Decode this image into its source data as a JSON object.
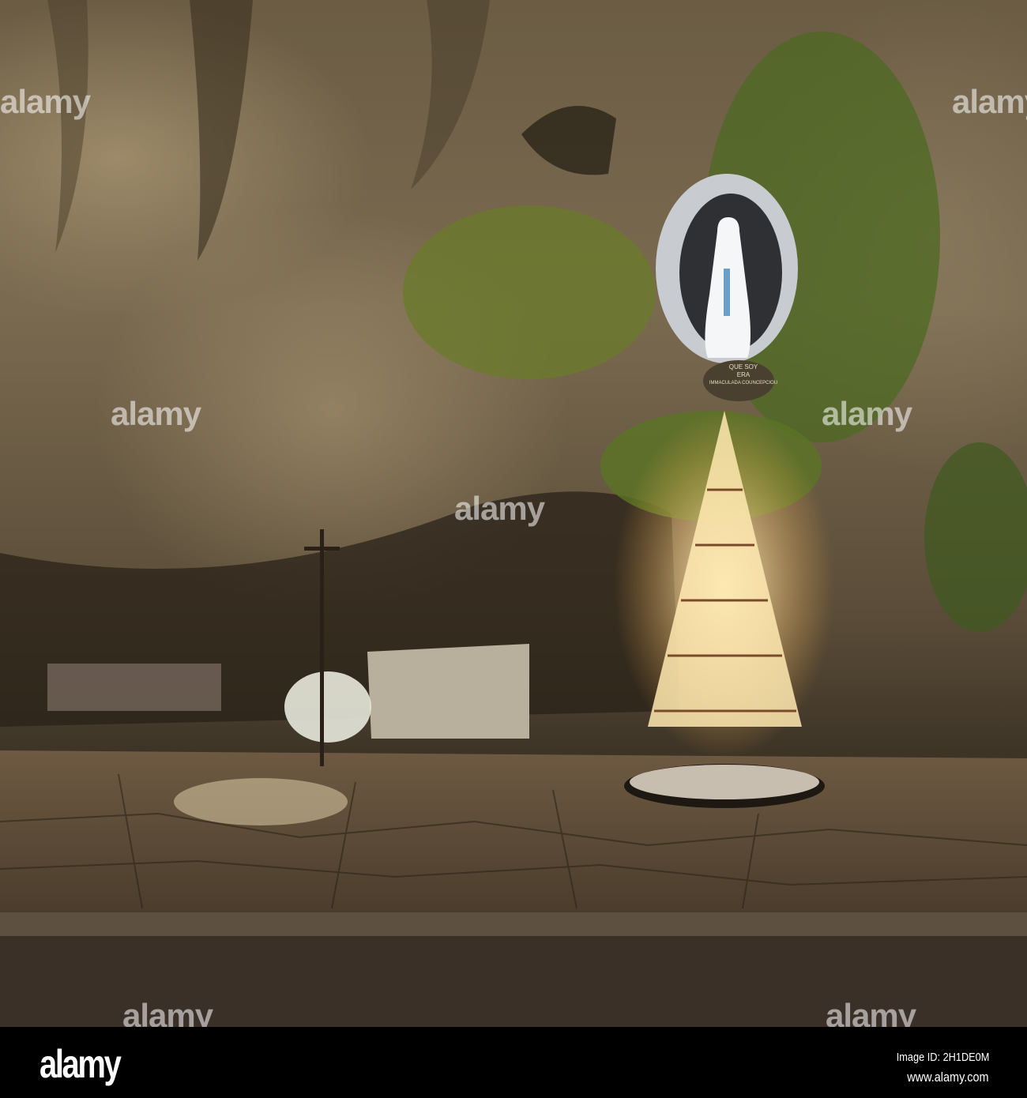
{
  "watermark": {
    "text": "alamy"
  },
  "inscription": {
    "line1": "QUE SOY",
    "line2": "ERA",
    "line3": "IMMACULADA COUNCEPCIOU"
  },
  "footer": {
    "logo": "alamy",
    "image_id": "Image ID: 2H1DE0M",
    "url": "www.alamy.com"
  }
}
